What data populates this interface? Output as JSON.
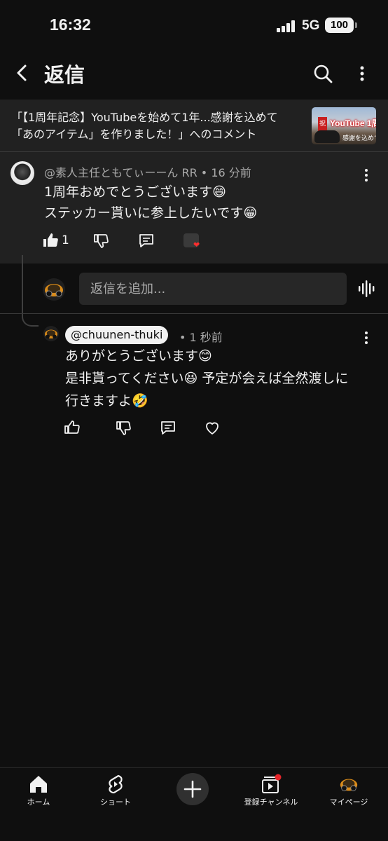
{
  "status_bar": {
    "time": "16:32",
    "network": "5G",
    "battery": "100"
  },
  "header": {
    "title": "返信"
  },
  "video": {
    "title_line1": "「【1周年記念】YouTubeを始めて1年...感謝を込めて",
    "title_line2": "「あのアイテム」を作りました！」へのコメント",
    "thumb_badge": "祝",
    "thumb_text": "YouTube 1周年",
    "thumb_sub": "感謝を込めて"
  },
  "parent_comment": {
    "author": "@素人主任ともてぃーーん RR",
    "time": "16 分前",
    "text_line1": "1周年おめでとうございます😄",
    "text_line2": "ステッカー貰いに参上したいです😁",
    "like_count": "1"
  },
  "compose": {
    "placeholder": "返信を追加..."
  },
  "reply_comment": {
    "mention": "@chuunen-thuki",
    "time": "1 秒前",
    "text_line1": "ありがとうございます😊",
    "text_line2": "是非貰ってください😆 予定が会えば全然渡しに",
    "text_line3": "行きますよ🤣"
  },
  "bottom_nav": {
    "items": [
      {
        "label": "ホーム",
        "icon": "home-icon"
      },
      {
        "label": "ショート",
        "icon": "shorts-icon"
      },
      {
        "label": "",
        "icon": "create-icon"
      },
      {
        "label": "登録チャンネル",
        "icon": "subscriptions-icon"
      },
      {
        "label": "マイページ",
        "icon": "profile-icon"
      }
    ]
  },
  "colors": {
    "background": "#0f0f0f",
    "panel": "#212121",
    "heart": "#ff2d2d",
    "notification": "#e5252a"
  }
}
